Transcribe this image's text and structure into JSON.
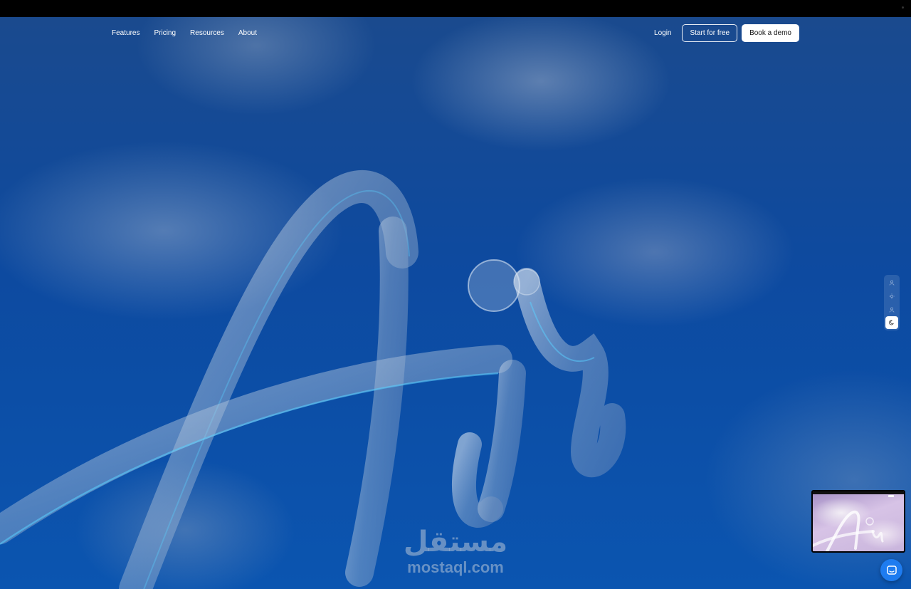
{
  "nav": {
    "links": [
      {
        "label": "Features"
      },
      {
        "label": "Pricing"
      },
      {
        "label": "Resources"
      },
      {
        "label": "About"
      }
    ],
    "login_label": "Login",
    "start_label": "Start for free",
    "demo_label": "Book a demo"
  },
  "theme_switcher": {
    "options": [
      "user-icon",
      "sun-icon",
      "user-icon",
      "moon-icon"
    ],
    "active": "moon-icon"
  },
  "watermark": {
    "arabic": "مستقل",
    "latin": "mostaql.com"
  },
  "colors": {
    "sky": "#0d4aa0",
    "glass_highlight": "#5ad0ff",
    "chat_button": "#1e7cf0"
  }
}
